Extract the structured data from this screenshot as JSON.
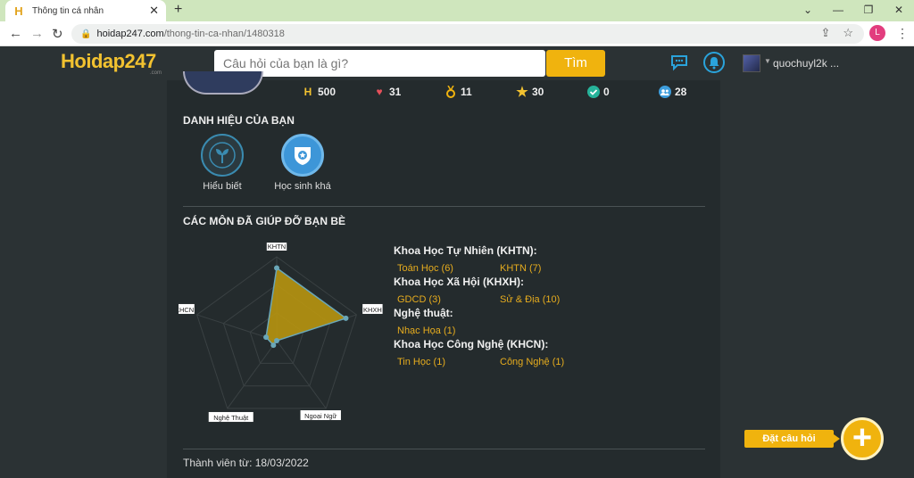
{
  "browser": {
    "tab_title": "Thông tin cá nhân",
    "url_host": "hoidap247.com",
    "url_path": "/thong-tin-ca-nhan/1480318",
    "profile_initial": "L"
  },
  "header": {
    "logo": "Hoidap247",
    "logo_sub": ".com",
    "search_placeholder": "Câu hỏi của bạn là gì?",
    "search_button": "Tìm",
    "username": "quochuyl2k ..."
  },
  "stats": [
    {
      "icon": "h-points-icon",
      "value": "500",
      "color": "#f2c230"
    },
    {
      "icon": "heart-icon",
      "value": "31",
      "color": "#e5505a"
    },
    {
      "icon": "medal-icon",
      "value": "11",
      "color": "#f0b30e"
    },
    {
      "icon": "star-icon",
      "value": "30",
      "color": "#f2c230"
    },
    {
      "icon": "check-circle-icon",
      "value": "0",
      "color": "#26b39a"
    },
    {
      "icon": "users-icon",
      "value": "28",
      "color": "#3d9ddc"
    }
  ],
  "titles_section": {
    "heading": "DANH HIỆU CỦA BẠN",
    "badges": [
      {
        "label": "Hiểu biết",
        "icon": "plant-icon"
      },
      {
        "label": "Học sinh khá",
        "icon": "shield-star-icon"
      }
    ]
  },
  "subjects_section": {
    "heading": "CÁC MÔN ĐÃ GIÚP ĐỠ BẠN BÈ",
    "radar": {
      "axes": [
        "KHTN",
        "KHXH",
        "Ngoại Ngữ",
        "Nghệ Thuật",
        "KHCN"
      ],
      "values": [
        13,
        13,
        0,
        1,
        2
      ],
      "max": 15
    },
    "groups": [
      {
        "title": "Khoa Học Tự Nhiên (KHTN):",
        "items": [
          "Toán Học (6)",
          "KHTN (7)"
        ]
      },
      {
        "title": "Khoa Học Xã Hội (KHXH):",
        "items": [
          "GDCD (3)",
          "Sử & Địa (10)"
        ]
      },
      {
        "title": "Nghệ thuật:",
        "items": [
          "Nhạc Họa (1)"
        ]
      },
      {
        "title": "Khoa Học Công Nghệ (KHCN):",
        "items": [
          "Tin Học (1)",
          "Công Nghệ (1)"
        ]
      }
    ]
  },
  "member_since": "Thành viên từ: 18/03/2022",
  "ask": {
    "label": "Đặt câu hỏi",
    "fab": "+"
  },
  "colors": {
    "accent": "#f0b30e",
    "link": "#e6ac1e",
    "blue": "#2aa3db"
  }
}
